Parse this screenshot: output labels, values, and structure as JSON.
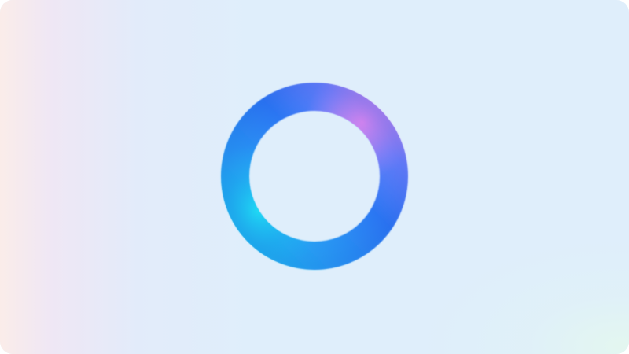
{
  "background": {
    "base_color": "#dfeefb",
    "left_tint_color": "#fbe9ea",
    "right_tint_color": "#e4f8ee"
  },
  "assistant_orb": {
    "icon": "assistant-ring-icon",
    "colors": {
      "primary_blue": "#2f7cf6",
      "deep_blue": "#1f63e8",
      "cyan": "#19d7f0",
      "pink": "#f08ae8",
      "violet": "#b58cff"
    }
  }
}
